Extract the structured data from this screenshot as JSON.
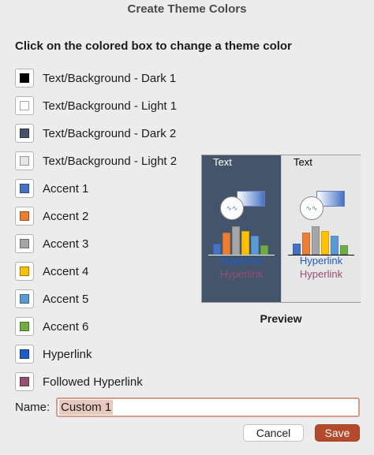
{
  "window": {
    "title": "Create Theme Colors"
  },
  "instruction": "Click on the colored box to change a theme color",
  "theme_colors": [
    {
      "label": "Text/Background - Dark 1",
      "color": "#000000"
    },
    {
      "label": "Text/Background - Light 1",
      "color": "#ffffff"
    },
    {
      "label": "Text/Background - Dark 2",
      "color": "#44546a"
    },
    {
      "label": "Text/Background - Light 2",
      "color": "#e7e6e6"
    },
    {
      "label": "Accent 1",
      "color": "#4472c4"
    },
    {
      "label": "Accent 2",
      "color": "#ed7d31"
    },
    {
      "label": "Accent 3",
      "color": "#a5a5a5"
    },
    {
      "label": "Accent 4",
      "color": "#ffc000"
    },
    {
      "label": "Accent 5",
      "color": "#5b9bd5"
    },
    {
      "label": "Accent 6",
      "color": "#70ad47"
    },
    {
      "label": "Hyperlink",
      "color": "#1f5dc6"
    },
    {
      "label": "Followed Hyperlink",
      "color": "#954f72"
    }
  ],
  "preview": {
    "label": "Preview",
    "dark_panel": {
      "text": "Text",
      "hyperlink": "Hyperlink",
      "followed_hyperlink": "Hyperlink",
      "background": "#44546a",
      "text_color": "#ffffff"
    },
    "light_panel": {
      "text": "Text",
      "hyperlink": "Hyperlink",
      "followed_hyperlink": "Hyperlink",
      "background": "#e7e6e6",
      "text_color": "#000000"
    }
  },
  "name_field": {
    "label": "Name:",
    "value": "Custom 1"
  },
  "buttons": {
    "cancel": "Cancel",
    "save": "Save"
  }
}
